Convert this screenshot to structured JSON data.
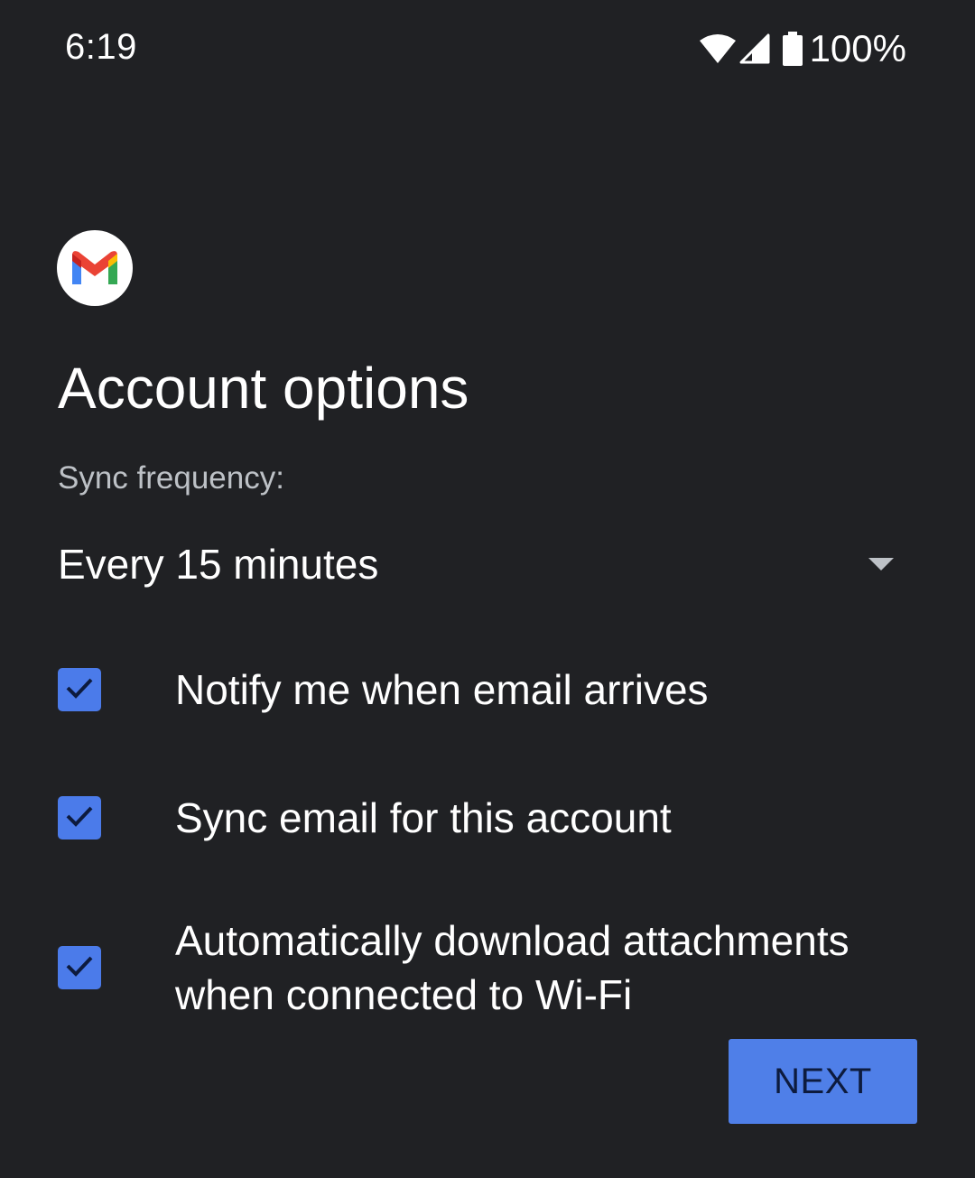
{
  "status_bar": {
    "time": "6:19",
    "battery": "100%",
    "icons": [
      "wifi-icon",
      "cell-signal-icon",
      "battery-icon"
    ]
  },
  "app": {
    "logo_icon": "gmail-logo-icon"
  },
  "page": {
    "title": "Account options"
  },
  "sync": {
    "label": "Sync frequency:",
    "selected": "Every 15 minutes",
    "arrow_icon": "dropdown-arrow-icon"
  },
  "options": [
    {
      "label": "Notify me when email arrives",
      "checked": true
    },
    {
      "label": "Sync email for this account",
      "checked": true
    },
    {
      "label": "Automatically download attachments when connected to Wi-Fi",
      "checked": true
    }
  ],
  "actions": {
    "next_label": "NEXT"
  },
  "colors": {
    "background": "#202124",
    "accent": "#4b7bea",
    "text_primary": "#ffffff",
    "text_secondary": "#bdc1c6"
  }
}
